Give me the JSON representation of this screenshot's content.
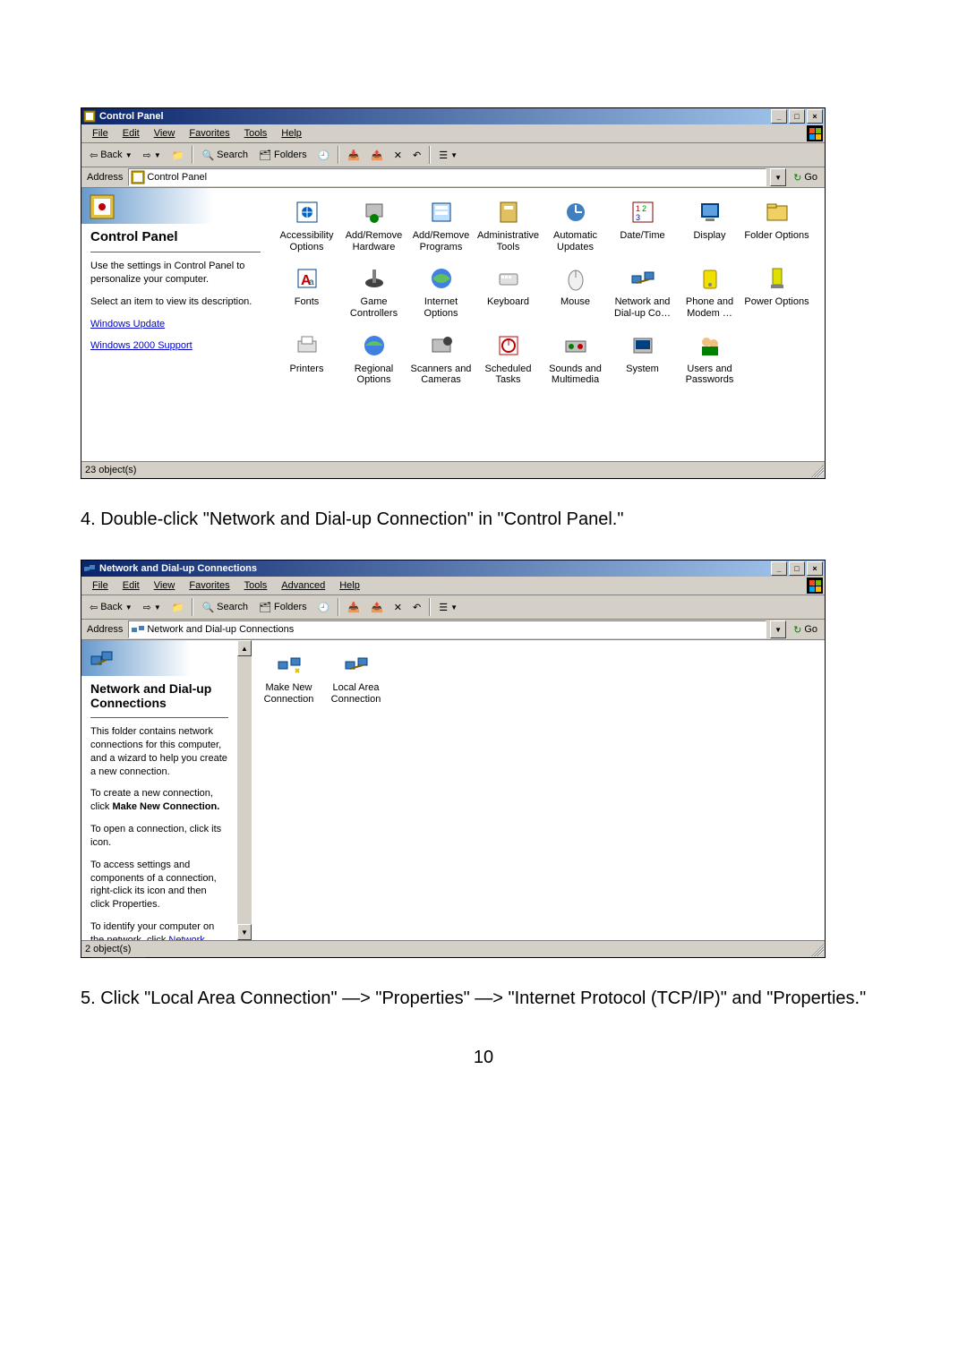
{
  "instruction1": "4. Double-click \"Network and Dial-up Connection\" in \"Control Panel.\"",
  "instruction2": "5. Click \"Local Area Connection\" —> \"Properties\" —> \"Internet Protocol (TCP/IP)\" and \"Properties.\"",
  "pageNumber": "10",
  "cp": {
    "title": "Control Panel",
    "menus": [
      "File",
      "Edit",
      "View",
      "Favorites",
      "Tools",
      "Help"
    ],
    "back": "Back",
    "search": "Search",
    "folders": "Folders",
    "addressLabel": "Address",
    "addressValue": "Control Panel",
    "go": "Go",
    "panelTitle": "Control Panel",
    "panelText1": "Use the settings in Control Panel to personalize your computer.",
    "panelText2": "Select an item to view its description.",
    "link1": "Windows Update",
    "link2": "Windows 2000 Support",
    "status": "23 object(s)",
    "items": [
      "Accessibility Options",
      "Add/Remove Hardware",
      "Add/Remove Programs",
      "Administrative Tools",
      "Automatic Updates",
      "Date/Time",
      "Display",
      "Folder Options",
      "Fonts",
      "Game Controllers",
      "Internet Options",
      "Keyboard",
      "Mouse",
      "Network and Dial-up Co…",
      "Phone and Modem …",
      "Power Options",
      "Printers",
      "Regional Options",
      "Scanners and Cameras",
      "Scheduled Tasks",
      "Sounds and Multimedia",
      "System",
      "Users and Passwords"
    ]
  },
  "nd": {
    "title": "Network and Dial-up Connections",
    "menus": [
      "File",
      "Edit",
      "View",
      "Favorites",
      "Tools",
      "Advanced",
      "Help"
    ],
    "back": "Back",
    "search": "Search",
    "folders": "Folders",
    "addressLabel": "Address",
    "addressValue": "Network and Dial-up Connections",
    "go": "Go",
    "panelTitle": "Network and Dial-up Connections",
    "p1": "This folder contains network connections for this computer, and a wizard to help you create a new connection.",
    "p2a": "To create a new connection, click ",
    "p2b": "Make New Connection.",
    "p3": "To open a connection, click its icon.",
    "p4": "To access settings and components of a connection, right-click its icon and then click Properties.",
    "p5a": "To identify your computer on the network, click ",
    "p5b": "Network Identification",
    "p5c": ".",
    "status": "2 object(s)",
    "items": [
      "Make New Connection",
      "Local Area Connection"
    ]
  }
}
